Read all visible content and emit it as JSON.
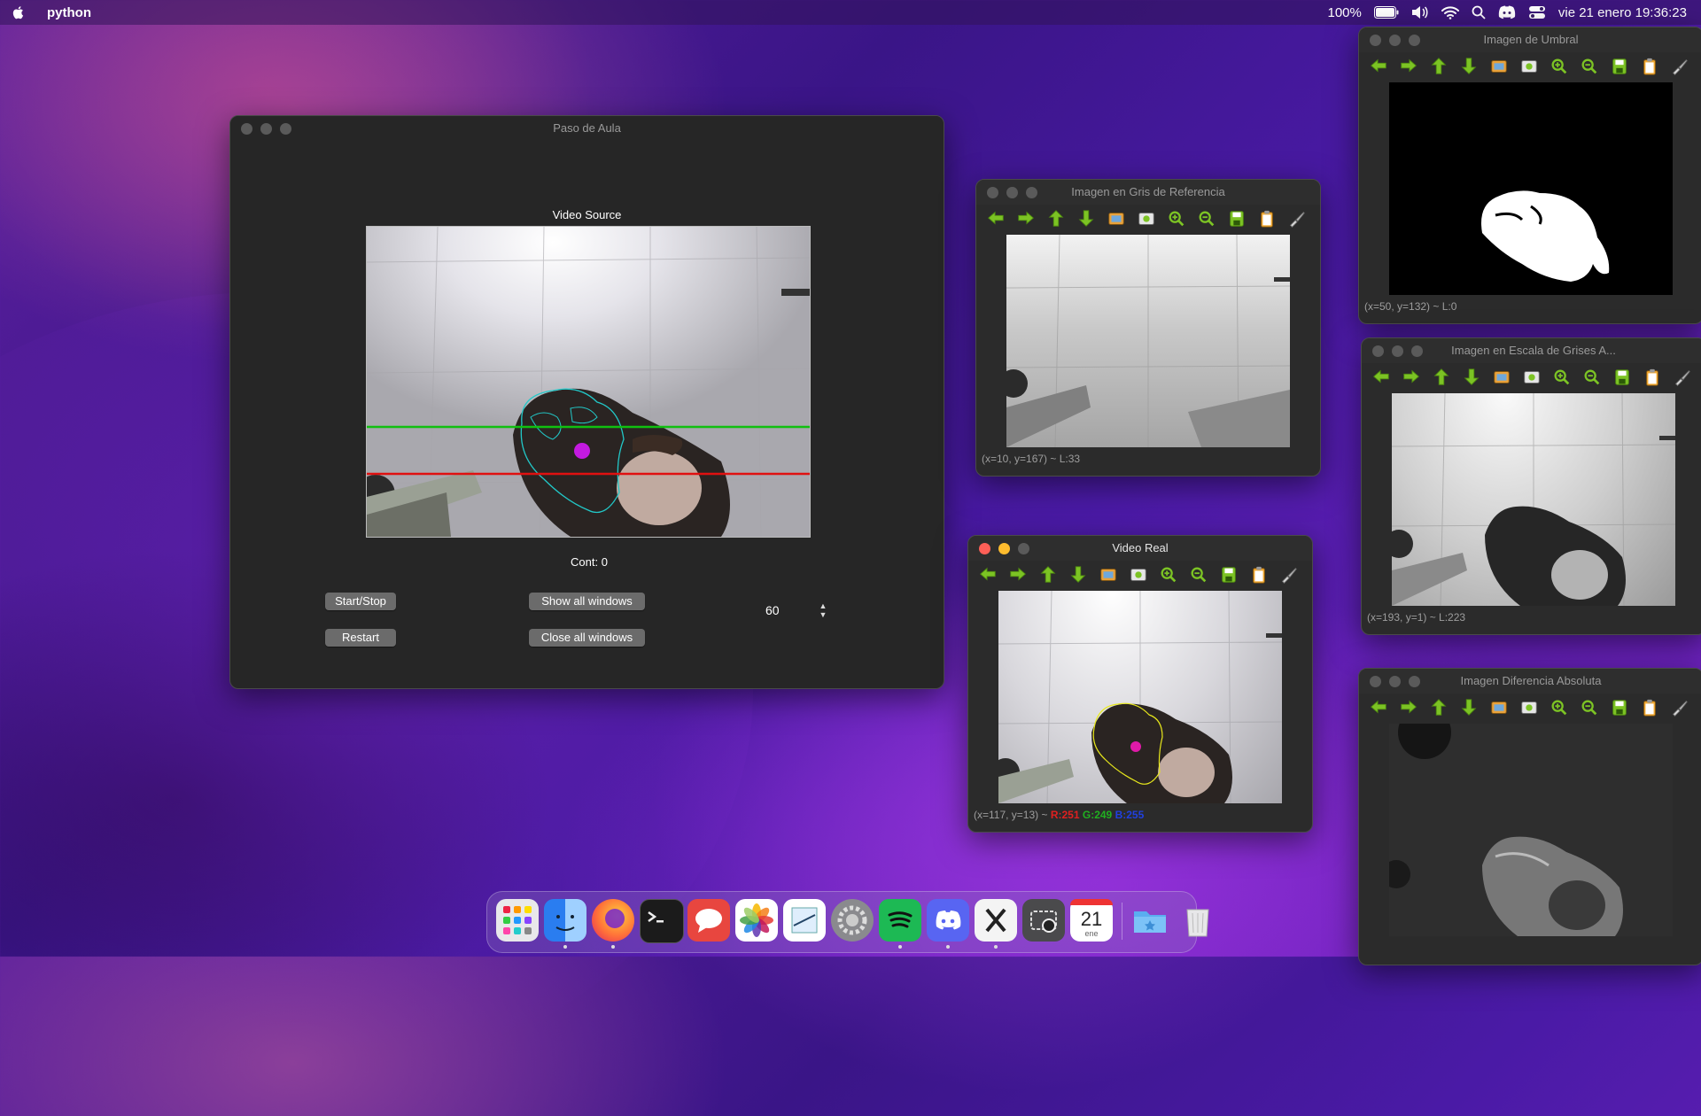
{
  "menubar": {
    "app_name": "python",
    "battery": "100%",
    "datetime": "vie 21 enero 19:36:23"
  },
  "main_window": {
    "title": "Paso de Aula",
    "video_label": "Video Source",
    "counter": "Cont: 0",
    "buttons": {
      "start_stop": "Start/Stop",
      "restart": "Restart",
      "show_all": "Show all windows",
      "close_all": "Close all windows"
    },
    "spin_value": "60"
  },
  "windows": {
    "gray_ref": {
      "title": "Imagen en Gris de Referencia",
      "status": "(x=10, y=167) ~ L:33"
    },
    "video_real": {
      "title": "Video Real",
      "status_pos": "(x=117, y=13) ~",
      "r": "R:251",
      "g": "G:249",
      "b": "B:255"
    },
    "threshold": {
      "title": "Imagen de Umbral",
      "status": "(x=50, y=132) ~ L:0"
    },
    "gray_scale": {
      "title": "Imagen en Escala de Grises A...",
      "status": "(x=193, y=1) ~ L:223"
    },
    "abs_diff": {
      "title": "Imagen Diferencia Absoluta"
    }
  },
  "toolbar_icons": [
    "arrow-left-icon",
    "arrow-right-icon",
    "arrow-up-icon",
    "arrow-down-icon",
    "image-icon",
    "screenshot-icon",
    "zoom-in-icon",
    "zoom-out-icon",
    "save-icon",
    "clipboard-icon",
    "brush-icon"
  ],
  "dock": {
    "calendar_day": "21",
    "calendar_month": "ene",
    "apps": [
      "launchpad",
      "finder",
      "firefox",
      "terminal",
      "speakerdeck",
      "photos",
      "preview",
      "system-preferences",
      "spotify",
      "discord",
      "x-app",
      "screenshot",
      "calendar",
      "folder",
      "trash"
    ]
  },
  "colors": {
    "green_line": "#10c010",
    "red_line": "#e01010",
    "contour": "#22c8c8",
    "marker": "#c41ae0"
  }
}
